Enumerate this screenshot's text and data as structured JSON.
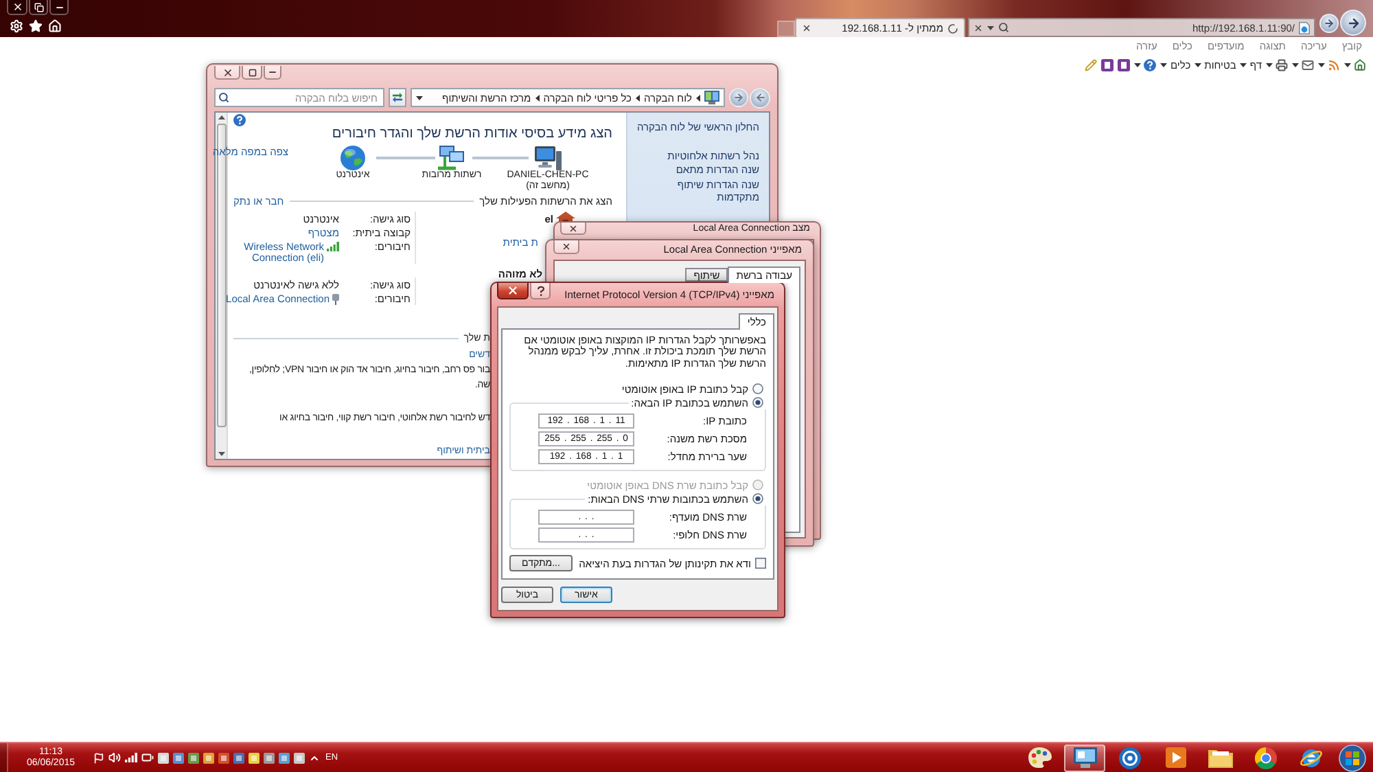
{
  "browser": {
    "tab": {
      "title": "ממתין ל- 192.168.1.11"
    },
    "address": {
      "value": "http://192.168.1.11:90/"
    },
    "menu": [
      "קובץ",
      "עריכה",
      "תצוגה",
      "מועדפים",
      "כלים",
      "עזרה"
    ],
    "command_menus": [
      "דף",
      "בטיחות",
      "כלים"
    ]
  },
  "network_window": {
    "active": false,
    "search": {
      "placeholder": "חיפוש בלוח הבקרה"
    },
    "breadcrumb": [
      "לוח הבקרה",
      "כל פריטי לוח הבקרה",
      "מרכז הרשת והשיתוף"
    ],
    "tasks": [
      "החלון הראשי של לוח הבקרה",
      "נהל רשתות אלחוטיות",
      "שנה הגדרות מתאם",
      "שנה הגדרות שיתוף מתקדמות"
    ],
    "heading": "הצג מידע בסיסי אודות הרשת שלך והגדר חיבורים",
    "full_map_link": "צפה במפה מלאה",
    "map_nodes": [
      {
        "kind": "computer",
        "label": "DANIEL-CHEN-PC",
        "sublabel": "(מחשב זה)"
      },
      {
        "kind": "networks",
        "label": "רשתות מרובות"
      },
      {
        "kind": "internet",
        "label": "אינטרנט"
      }
    ],
    "active_header": "הצג את הרשתות הפעילות שלך",
    "connect_link": "חבר או נתק",
    "networks": [
      {
        "name": "el",
        "category_link": "ת ביתית",
        "details": [
          {
            "label": "סוג גישה:",
            "value": "אינטרנט",
            "kind": "text"
          },
          {
            "label": "קבוצה ביתית:",
            "value": "מצטרף",
            "kind": "link"
          },
          {
            "label": "חיבורים:",
            "value": "Wireless Network Connection (eli)",
            "kind": "wireless"
          }
        ]
      },
      {
        "name": "לא מזוהה",
        "details": [
          {
            "label": "סוג גישה:",
            "value": "ללא גישה לאינטרנט",
            "kind": "text"
          },
          {
            "label": "חיבורים:",
            "value": "Local Area Connection",
            "kind": "wired"
          }
        ]
      }
    ],
    "change_section": {
      "header": "ת שלך",
      "items": [
        {
          "link": "דשים",
          "lines": [
            "בור פס רחב, חיבור בחיוג, חיבור אד הוק או חיבור VPN; לחלופין,",
            "שה."
          ]
        },
        {
          "lines": [
            "דש לחיבור רשת אלחוטי, חיבור רשת קווי, חיבור בחיוג או"
          ]
        },
        {
          "link": "ביתית ושיתוף"
        }
      ]
    }
  },
  "status_dialog": {
    "active": false,
    "title": "מצב Local Area Connection"
  },
  "props_dialog": {
    "active": false,
    "title": "מאפייני Local Area Connection",
    "tabs": [
      {
        "label": "עבודה ברשת",
        "selected": true
      },
      {
        "label": "שיתוף",
        "selected": false
      }
    ]
  },
  "ipv4_dialog": {
    "active": true,
    "title": "מאפייני Internet Protocol Version 4 (TCP/IPv4)",
    "tabs": [
      {
        "label": "כללי",
        "selected": true
      }
    ],
    "intro": "באפשרותך לקבל הגדרות IP המוקצות באופן אוטומטי אם הרשת שלך תומכת ביכולת זו. אחרת, עליך לבקש ממנהל הרשת שלך הגדרות IP מתאימות.",
    "ip_options": [
      {
        "label": "קבל כתובת IP באופן אוטומטי",
        "selected": false,
        "disabled": false
      },
      {
        "label": "השתמש בכתובת IP הבאה:",
        "selected": true,
        "disabled": false
      }
    ],
    "ip_fields": [
      {
        "label": "כתובת IP:",
        "value": "192 . 168 . 1 . 11"
      },
      {
        "label": "מסכת רשת משנה:",
        "value": "255 . 255 . 255 . 0"
      },
      {
        "label": "שער ברירת מחדל:",
        "value": "192 . 168 . 1 . 1"
      }
    ],
    "dns_options": [
      {
        "label": "קבל כתובת שרת DNS באופן אוטומטי",
        "selected": false,
        "disabled": true
      },
      {
        "label": "השתמש בכתובות שרתי DNS הבאות:",
        "selected": true,
        "disabled": false
      }
    ],
    "dns_fields": [
      {
        "label": "שרת DNS מועדף:",
        "value": ". . ."
      },
      {
        "label": "שרת DNS חלופי:",
        "value": ". . ."
      }
    ],
    "validate": {
      "label": "ודא את תקינותן של הגדרות בעת היציאה",
      "checked": false
    },
    "advanced_button": "מתקדם...",
    "buttons": [
      {
        "label": "אישור",
        "default": true
      },
      {
        "label": "ביטול",
        "default": false
      }
    ]
  },
  "taskbar": {
    "clock": {
      "time": "11:13",
      "date": "06/06/2015"
    },
    "language": "EN",
    "apps": [
      {
        "kind": "ie",
        "selected": false
      },
      {
        "kind": "chrome",
        "selected": false
      },
      {
        "kind": "explorer",
        "selected": false
      },
      {
        "kind": "media",
        "selected": false
      },
      {
        "kind": "target",
        "selected": false
      },
      {
        "kind": "panel",
        "selected": true
      },
      {
        "kind": "paint",
        "selected": false
      }
    ]
  }
}
